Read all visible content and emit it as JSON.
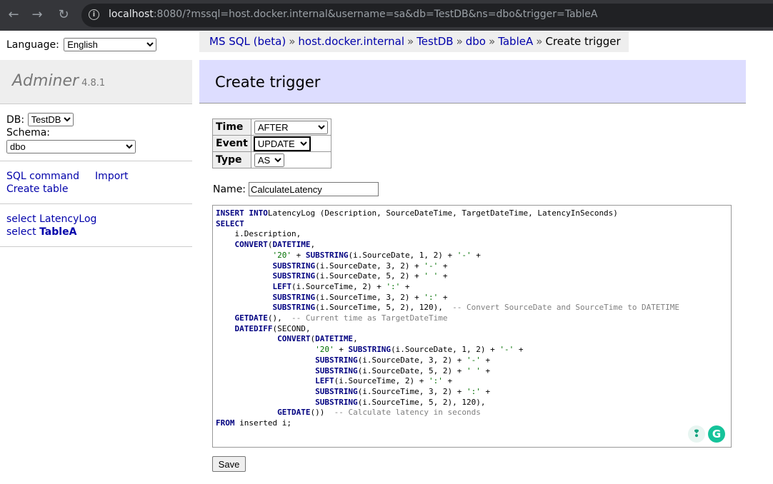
{
  "browser": {
    "url_host": "localhost",
    "url_rest": ":8080/?mssql=host.docker.internal&username=sa&db=TestDB&ns=dbo&trigger=TableA",
    "back_icon": "←",
    "forward_icon": "→",
    "reload_icon": "↻",
    "info_icon": "i"
  },
  "language": {
    "label": "Language:",
    "selected": "English"
  },
  "breadcrumb": {
    "items": [
      "MS SQL (beta)",
      "host.docker.internal",
      "TestDB",
      "dbo",
      "TableA"
    ],
    "separator": "»",
    "current": "Create trigger"
  },
  "app": {
    "name": "Adminer",
    "version": "4.8.1"
  },
  "db_selector": {
    "db_label": "DB:",
    "db_value": "TestDB",
    "schema_label": "Schema:",
    "schema_value": "dbo"
  },
  "links": {
    "sql_command": "SQL command",
    "import": "Import",
    "create_table": "Create table"
  },
  "tables": [
    {
      "prefix": "select",
      "name": "LatencyLog"
    },
    {
      "prefix": "select",
      "name": "TableA"
    }
  ],
  "page": {
    "title": "Create trigger"
  },
  "trigger_form": {
    "time_label": "Time",
    "time_value": "AFTER",
    "event_label": "Event",
    "event_value": "UPDATE",
    "type_label": "Type",
    "type_value": "AS",
    "name_label": "Name:",
    "name_value": "CalculateLatency",
    "save_label": "Save"
  },
  "sql_lines": [
    [
      [
        "kw",
        "INSERT INTO"
      ],
      [
        "",
        "LatencyLog (Description, SourceDateTime, TargetDateTime, LatencyInSeconds)"
      ]
    ],
    [
      [
        "kw",
        "SELECT"
      ]
    ],
    [
      [
        "",
        "    i.Description,"
      ]
    ],
    [
      [
        "",
        "    "
      ],
      [
        "kw",
        "CONVERT"
      ],
      [
        "",
        "("
      ],
      [
        "kw",
        "DATETIME"
      ],
      [
        "",
        ","
      ]
    ],
    [
      [
        "",
        "            "
      ],
      [
        "str",
        "'20'"
      ],
      [
        "",
        " + "
      ],
      [
        "kw",
        "SUBSTRING"
      ],
      [
        "",
        "(i.SourceDate, 1, 2) + "
      ],
      [
        "str",
        "'-'"
      ],
      [
        "",
        " +"
      ]
    ],
    [
      [
        "",
        "            "
      ],
      [
        "kw",
        "SUBSTRING"
      ],
      [
        "",
        "(i.SourceDate, 3, 2) + "
      ],
      [
        "str",
        "'-'"
      ],
      [
        "",
        " +"
      ]
    ],
    [
      [
        "",
        "            "
      ],
      [
        "kw",
        "SUBSTRING"
      ],
      [
        "",
        "(i.SourceDate, 5, 2) + "
      ],
      [
        "str",
        "' '"
      ],
      [
        "",
        " +"
      ]
    ],
    [
      [
        "",
        "            "
      ],
      [
        "kw",
        "LEFT"
      ],
      [
        "",
        "(i.SourceTime, 2) + "
      ],
      [
        "str",
        "':'"
      ],
      [
        "",
        " +"
      ]
    ],
    [
      [
        "",
        "            "
      ],
      [
        "kw",
        "SUBSTRING"
      ],
      [
        "",
        "(i.SourceTime, 3, 2) + "
      ],
      [
        "str",
        "':'"
      ],
      [
        "",
        " +"
      ]
    ],
    [
      [
        "",
        "            "
      ],
      [
        "kw",
        "SUBSTRING"
      ],
      [
        "",
        "(i.SourceTime, 5, 2), 120),  "
      ],
      [
        "cm",
        "-- Convert SourceDate and SourceTime to DATETIME"
      ]
    ],
    [
      [
        "",
        "    "
      ],
      [
        "kw",
        "GETDATE"
      ],
      [
        "",
        "(),  "
      ],
      [
        "cm",
        "-- Current time as TargetDateTime"
      ]
    ],
    [
      [
        "",
        "    "
      ],
      [
        "kw",
        "DATEDIFF"
      ],
      [
        "",
        "(SECOND,"
      ]
    ],
    [
      [
        "",
        "             "
      ],
      [
        "kw",
        "CONVERT"
      ],
      [
        "",
        "("
      ],
      [
        "kw",
        "DATETIME"
      ],
      [
        "",
        ","
      ]
    ],
    [
      [
        "",
        "                     "
      ],
      [
        "str",
        "'20'"
      ],
      [
        "",
        " + "
      ],
      [
        "kw",
        "SUBSTRING"
      ],
      [
        "",
        "(i.SourceDate, 1, 2) + "
      ],
      [
        "str",
        "'-'"
      ],
      [
        "",
        " +"
      ]
    ],
    [
      [
        "",
        "                     "
      ],
      [
        "kw",
        "SUBSTRING"
      ],
      [
        "",
        "(i.SourceDate, 3, 2) + "
      ],
      [
        "str",
        "'-'"
      ],
      [
        "",
        " +"
      ]
    ],
    [
      [
        "",
        "                     "
      ],
      [
        "kw",
        "SUBSTRING"
      ],
      [
        "",
        "(i.SourceDate, 5, 2) + "
      ],
      [
        "str",
        "' '"
      ],
      [
        "",
        " +"
      ]
    ],
    [
      [
        "",
        "                     "
      ],
      [
        "kw",
        "LEFT"
      ],
      [
        "",
        "(i.SourceTime, 2) + "
      ],
      [
        "str",
        "':'"
      ],
      [
        "",
        " +"
      ]
    ],
    [
      [
        "",
        "                     "
      ],
      [
        "kw",
        "SUBSTRING"
      ],
      [
        "",
        "(i.SourceTime, 3, 2) + "
      ],
      [
        "str",
        "':'"
      ],
      [
        "",
        " +"
      ]
    ],
    [
      [
        "",
        "                     "
      ],
      [
        "kw",
        "SUBSTRING"
      ],
      [
        "",
        "(i.SourceTime, 5, 2), 120),"
      ]
    ],
    [
      [
        "",
        "             "
      ],
      [
        "kw",
        "GETDATE"
      ],
      [
        "",
        "())  "
      ],
      [
        "cm",
        "-- Calculate latency in seconds"
      ]
    ],
    [
      [
        "kw",
        "FROM"
      ],
      [
        "",
        " inserted i;"
      ]
    ]
  ],
  "grammarly": {
    "bulb_icon": "❢",
    "logo_letter": "G"
  }
}
